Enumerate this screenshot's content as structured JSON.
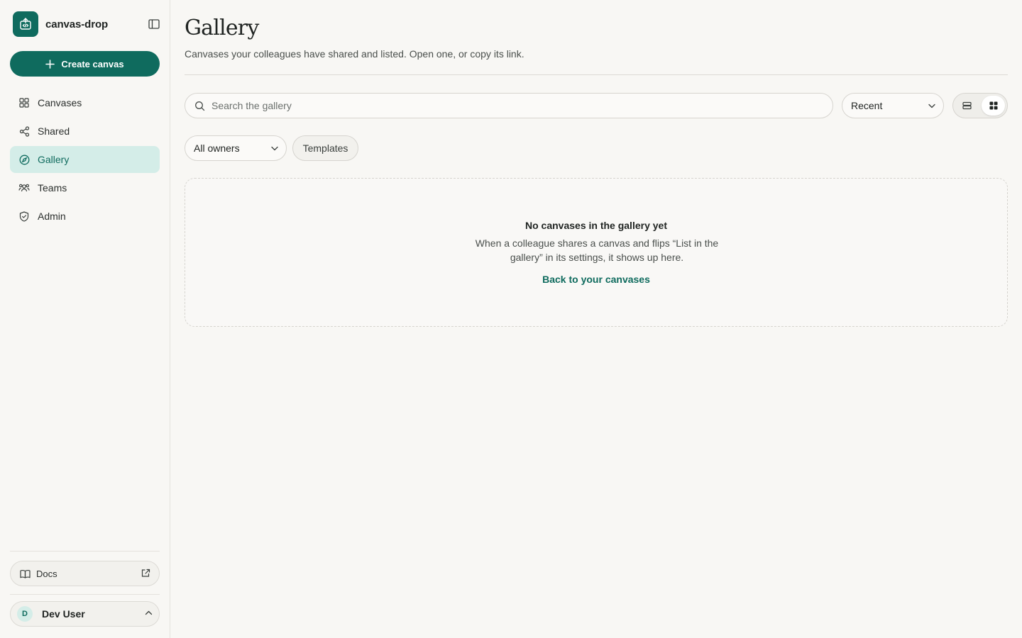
{
  "brand": {
    "name": "canvas-drop",
    "logo_icon": "upload-code-icon"
  },
  "sidebar": {
    "create_label": "Create canvas",
    "items": [
      {
        "label": "Canvases",
        "icon": "grid-icon",
        "active": false
      },
      {
        "label": "Shared",
        "icon": "share-icon",
        "active": false
      },
      {
        "label": "Gallery",
        "icon": "compass-icon",
        "active": true
      },
      {
        "label": "Teams",
        "icon": "users-icon",
        "active": false
      },
      {
        "label": "Admin",
        "icon": "shield-icon",
        "active": false
      }
    ],
    "docs_label": "Docs",
    "user": {
      "initial": "D",
      "name": "Dev User"
    }
  },
  "header": {
    "title": "Gallery",
    "subtitle": "Canvases your colleagues have shared and listed. Open one, or copy its link."
  },
  "toolbar": {
    "search_placeholder": "Search the gallery",
    "sort_value": "Recent",
    "view_mode": "grid",
    "owner_filter": "All owners",
    "templates_label": "Templates"
  },
  "empty_state": {
    "title": "No canvases in the gallery yet",
    "description": "When a colleague shares a canvas and flips “List in the gallery” in its settings, it shows up here.",
    "link_label": "Back to your canvases"
  },
  "colors": {
    "accent": "#0f6b5e",
    "accent_soft": "#d4ede8",
    "background": "#f8f7f4"
  }
}
